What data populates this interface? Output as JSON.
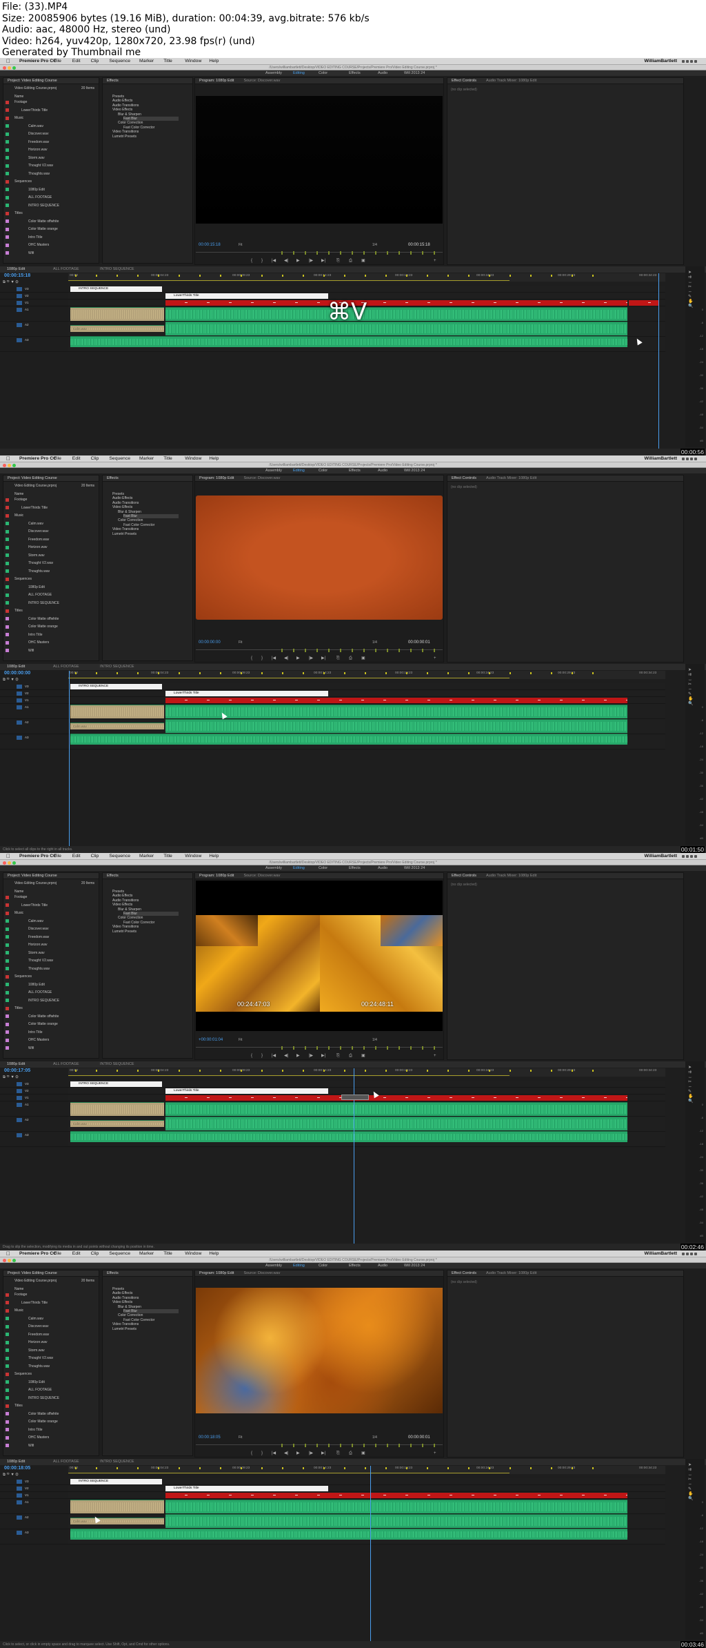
{
  "info": {
    "file": "File: (33).MP4",
    "size": "Size: 20085906 bytes (19.16 MiB), duration: 00:04:39, avg.bitrate: 576 kb/s",
    "audio": "Audio: aac, 48000 Hz, stereo (und)",
    "video": "Video: h264, yuv420p, 1280x720, 23.98 fps(r) (und)",
    "generator": "Generated by Thumbnail me"
  },
  "menu": {
    "app": "Premiere Pro CC",
    "items": [
      "File",
      "Edit",
      "Clip",
      "Sequence",
      "Marker",
      "Title",
      "Window",
      "Help"
    ],
    "user": "WilliamBartlett"
  },
  "title_path": "/Users/williambartlett/Desktop/VIDEO EDITING COURSE/Projects/Premiere Pro/Video Editing Course.prproj *",
  "workspaces": [
    "Assembly",
    "Editing",
    "Color",
    "Effects",
    "Audio",
    "Will 2013 24"
  ],
  "project": {
    "title": "Project: Video Editing Course",
    "file": "Video Editing Course.prproj",
    "count": "20 Items",
    "name_header": "Name",
    "items": [
      {
        "label": "Footage",
        "color": "#c93434",
        "indent": 0
      },
      {
        "label": "LowerThirds Title",
        "color": "#c93434",
        "indent": 1
      },
      {
        "label": "Music",
        "color": "#c93434",
        "indent": 0
      },
      {
        "label": "Calm.wav",
        "color": "#2bb673",
        "indent": 2
      },
      {
        "label": "Discover.wav",
        "color": "#2bb673",
        "indent": 2
      },
      {
        "label": "Freedom.wav",
        "color": "#2bb673",
        "indent": 2
      },
      {
        "label": "Horizon.wav",
        "color": "#2bb673",
        "indent": 2
      },
      {
        "label": "Storm.wav",
        "color": "#2bb673",
        "indent": 2
      },
      {
        "label": "Thought V2.wav",
        "color": "#2bb673",
        "indent": 2
      },
      {
        "label": "Thoughts.wav",
        "color": "#2bb673",
        "indent": 2
      },
      {
        "label": "Sequences",
        "color": "#c93434",
        "indent": 0
      },
      {
        "label": "1080p Edit",
        "color": "#2bb673",
        "indent": 2
      },
      {
        "label": "ALL FOOTAGE",
        "color": "#2bb673",
        "indent": 2
      },
      {
        "label": "INTRO SEQUENCE",
        "color": "#2bb673",
        "indent": 2
      },
      {
        "label": "Titles",
        "color": "#c93434",
        "indent": 0
      },
      {
        "label": "Color Matte offwhite",
        "color": "#c77dd4",
        "indent": 2
      },
      {
        "label": "Color Matte orange",
        "color": "#c77dd4",
        "indent": 2
      },
      {
        "label": "Intro Title",
        "color": "#c77dd4",
        "indent": 2
      },
      {
        "label": "OHC Masters",
        "color": "#c77dd4",
        "indent": 2
      },
      {
        "label": "Wifi",
        "color": "#c77dd4",
        "indent": 2
      }
    ]
  },
  "effects": {
    "title": "Effects",
    "items": [
      {
        "label": "Presets",
        "indent": 0,
        "sel": false
      },
      {
        "label": "Audio Effects",
        "indent": 0,
        "sel": false
      },
      {
        "label": "Audio Transitions",
        "indent": 0,
        "sel": false
      },
      {
        "label": "Video Effects",
        "indent": 0,
        "sel": false
      },
      {
        "label": "Blur & Sharpen",
        "indent": 1,
        "sel": false
      },
      {
        "label": "Fast Blur",
        "indent": 2,
        "sel": true
      },
      {
        "label": "Color Correction",
        "indent": 1,
        "sel": false
      },
      {
        "label": "Fast Color Corrector",
        "indent": 2,
        "sel": false
      },
      {
        "label": "Video Transitions",
        "indent": 0,
        "sel": false
      },
      {
        "label": "Lumetri Presets",
        "indent": 0,
        "sel": false
      }
    ]
  },
  "program": {
    "title": "Program: 1080p Edit",
    "source": "Source: Discover.wav"
  },
  "effect_controls": {
    "title": "Effect Controls",
    "mixer": "Audio Track Mixer: 1080p Edit",
    "no_clip": "(no clip selected)"
  },
  "timeline": {
    "tabs": [
      "1080p Edit",
      "ALL FOOTAGE",
      "INTRO SEQUENCE"
    ],
    "ruler": [
      "00:00",
      "00:00:04:23",
      "00:00:09:23",
      "00:00:14:23",
      "00:00:19:23",
      "00:00:24:23",
      "00:00:29:23",
      "00:00:34:23"
    ],
    "clip_intro": "INTRO SEQUENCE",
    "clip_lower": "LowerThirds Title",
    "clip_music": "Calm.wav",
    "tracks": [
      "V3",
      "V2",
      "V1",
      "A1",
      "A2",
      "A3"
    ],
    "meter_scale": [
      "0",
      "-6",
      "-12",
      "-18",
      "-24",
      "-30",
      "-36",
      "-42",
      "-48",
      "-54",
      "dB"
    ]
  },
  "monitor": {
    "fit": "Fit",
    "ratio": "1/4"
  },
  "frames": [
    {
      "timestamp": "00:00:56",
      "tc": "00:00:15:18",
      "dur": "00:00:15:18",
      "tl_tc": "00:00:15:18",
      "view": "black",
      "status": "",
      "overlay": "⌘V",
      "overlay_show": true,
      "tc_left": "",
      "tc_right": ""
    },
    {
      "timestamp": "00:01:50",
      "tc": "00:00:00:00",
      "dur": "00:00:00:01",
      "tl_tc": "00:00:00:00",
      "view": "orange",
      "status": "Click to select all clips to the right in all tracks.",
      "overlay": "",
      "overlay_show": false,
      "tc_left": "",
      "tc_right": ""
    },
    {
      "timestamp": "00:02:46",
      "tc": "+00:00:01:04",
      "dur": "",
      "tl_tc": "00:00:17:05",
      "view": "split",
      "status": "Drag to slip the selection, modifying its media in and out points without changing its position in time.",
      "overlay": "",
      "overlay_show": false,
      "tc_left": "00:24:47:03",
      "tc_right": "00:24:48:11"
    },
    {
      "timestamp": "00:03:46",
      "tc": "00:00:18:05",
      "dur": "00:00:00:01",
      "tl_tc": "00:00:18:05",
      "view": "leaves",
      "status": "Click to select, or click in empty space and drag to marquee select. Use Shift, Opt, and Cmd for other options.",
      "overlay": "",
      "overlay_show": false,
      "tc_left": "",
      "tc_right": ""
    }
  ],
  "colors": {
    "accent": "#4a9ff0",
    "video_clip": "#c01616",
    "audio_clip": "#27a86a",
    "title_clip": "#f2f2f2"
  }
}
